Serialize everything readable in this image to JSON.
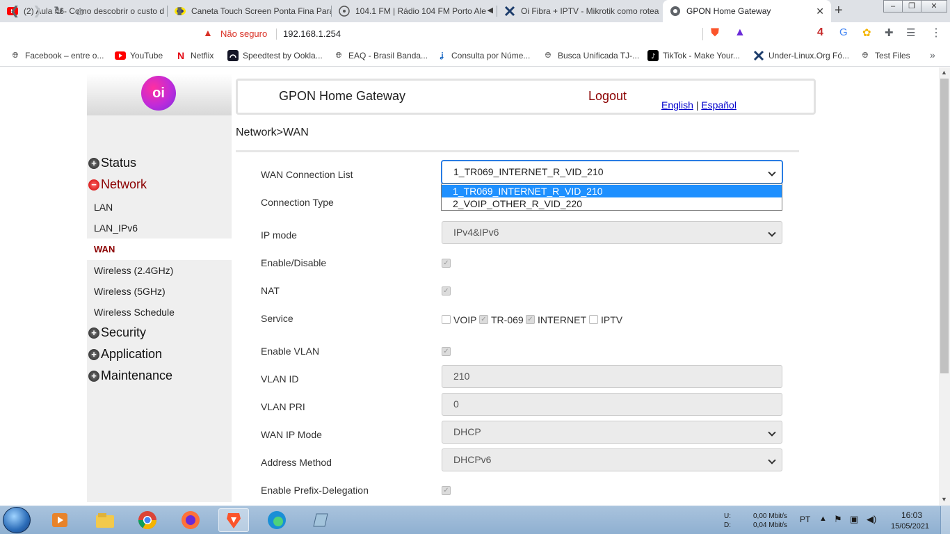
{
  "browser": {
    "tabs": [
      {
        "title": "(2) Aula #6- Como descobrir o custo d",
        "icon": "youtube-icon"
      },
      {
        "title": "Caneta Touch Screen Ponta Fina Para",
        "icon": "marketplace-icon"
      },
      {
        "title": "104.1 FM | Rádio 104 FM Porto Ale",
        "icon": "radio-icon"
      },
      {
        "title": "Oi Fibra + IPTV - Mikrotik como rotea",
        "icon": "forum-icon"
      },
      {
        "title": "GPON Home Gateway",
        "icon": "globe-icon",
        "active": true
      }
    ],
    "security_label": "Não seguro",
    "url": "192.168.1.254",
    "extension_badge": "4",
    "bookmarks": [
      "Facebook – entre o...",
      "YouTube",
      "Netflix",
      "Speedtest by Ookla...",
      "EAQ - Brasil Banda...",
      "Consulta por Núme...",
      "Busca Unificada TJ-...",
      "TikTok - Make Your...",
      "Under-Linux.Org Fó...",
      "Test Files"
    ]
  },
  "router": {
    "logo_text": "oi",
    "header_title": "GPON Home Gateway",
    "logout": "Logout",
    "lang_en": "English",
    "lang_sep": "|",
    "lang_es": "Español",
    "breadcrumb": "Network>WAN",
    "menu": {
      "status": "Status",
      "network": "Network",
      "sub": [
        "LAN",
        "LAN_IPv6",
        "WAN",
        "Wireless (2.4GHz)",
        "Wireless (5GHz)",
        "Wireless Schedule"
      ],
      "security": "Security",
      "application": "Application",
      "maintenance": "Maintenance"
    },
    "form": {
      "wan_connection_list_label": "WAN Connection List",
      "wan_connection_selected": "1_TR069_INTERNET_R_VID_210",
      "wan_connection_options": [
        "1_TR069_INTERNET_R_VID_210",
        "2_VOIP_OTHER_R_VID_220"
      ],
      "connection_type_label": "Connection Type",
      "ip_mode_label": "IP mode",
      "ip_mode_value": "IPv4&IPv6",
      "enable_disable_label": "Enable/Disable",
      "nat_label": "NAT",
      "service_label": "Service",
      "services": [
        {
          "name": "VOIP",
          "checked": false
        },
        {
          "name": "TR-069",
          "checked": true
        },
        {
          "name": "INTERNET",
          "checked": true
        },
        {
          "name": "IPTV",
          "checked": false
        }
      ],
      "enable_vlan_label": "Enable VLAN",
      "vlan_id_label": "VLAN ID",
      "vlan_id_value": "210",
      "vlan_pri_label": "VLAN PRI",
      "vlan_pri_value": "0",
      "wan_ip_mode_label": "WAN IP Mode",
      "wan_ip_mode_value": "DHCP",
      "address_method_label": "Address Method",
      "address_method_value": "DHCPv6",
      "prefix_delegation_label": "Enable Prefix-Delegation"
    }
  },
  "taskbar": {
    "upload_label": "U:",
    "download_label": "D:",
    "upload_rate": "0,00 Mbit/s",
    "download_rate": "0,04 Mbit/s",
    "language": "PT",
    "time": "16:03",
    "date": "15/05/2021"
  }
}
